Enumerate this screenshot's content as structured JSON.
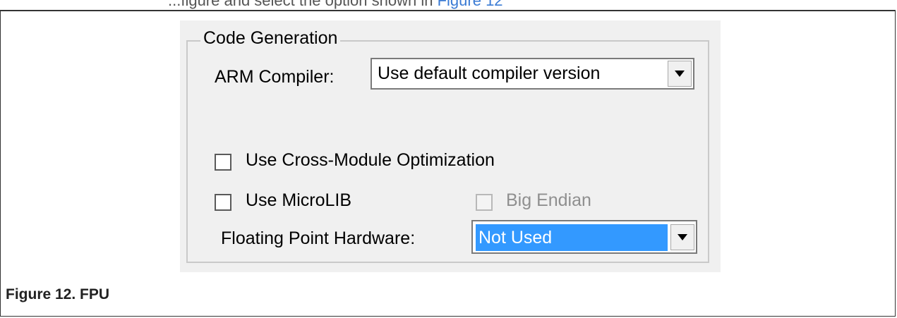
{
  "topline": {
    "text": "...figure and select the option shown in",
    "link": "Figure 12"
  },
  "group": {
    "title": "Code Generation"
  },
  "compiler": {
    "label": "ARM Compiler:",
    "value": "Use default compiler version"
  },
  "options": {
    "cross_module": {
      "label": "Use Cross-Module Optimization",
      "checked": false
    },
    "microlib": {
      "label": "Use MicroLIB",
      "checked": false
    },
    "big_endian": {
      "label": "Big Endian",
      "checked": false,
      "disabled": true
    }
  },
  "fpu": {
    "label": "Floating Point Hardware:",
    "value": "Not Used"
  },
  "caption": "Figure 12. FPU",
  "colors": {
    "selection": "#3399ff",
    "panel": "#f0f0f0",
    "link": "#3b7bd4"
  }
}
